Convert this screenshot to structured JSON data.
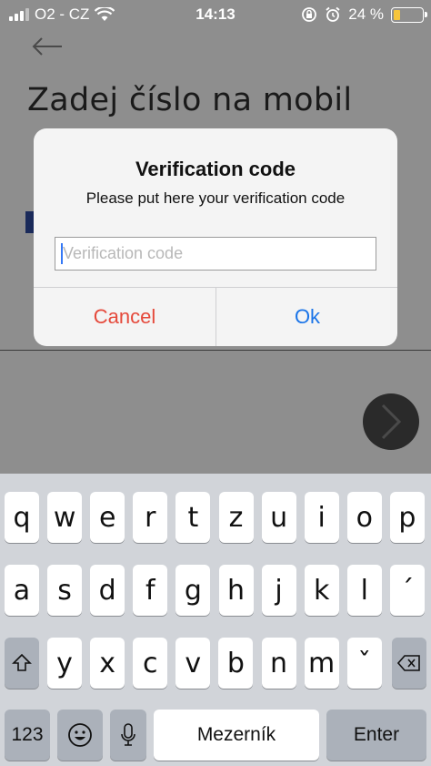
{
  "status_bar": {
    "carrier": "O2 - CZ",
    "time": "14:13",
    "battery_percent": "24 %",
    "battery_level": 0.24
  },
  "screen": {
    "title": "Zadej číslo na mobil"
  },
  "alert": {
    "title": "Verification code",
    "message": "Please put here your verification code",
    "input_placeholder": "Verification code",
    "input_value": "",
    "cancel_label": "Cancel",
    "ok_label": "Ok"
  },
  "keyboard": {
    "row1": [
      "q",
      "w",
      "e",
      "r",
      "t",
      "z",
      "u",
      "i",
      "o",
      "p"
    ],
    "row2": [
      "a",
      "s",
      "d",
      "f",
      "g",
      "h",
      "j",
      "k",
      "l",
      "´"
    ],
    "row3": [
      "y",
      "x",
      "c",
      "v",
      "b",
      "n",
      "m",
      "ˇ"
    ],
    "numbers_label": "123",
    "space_label": "Mezerník",
    "enter_label": "Enter"
  }
}
